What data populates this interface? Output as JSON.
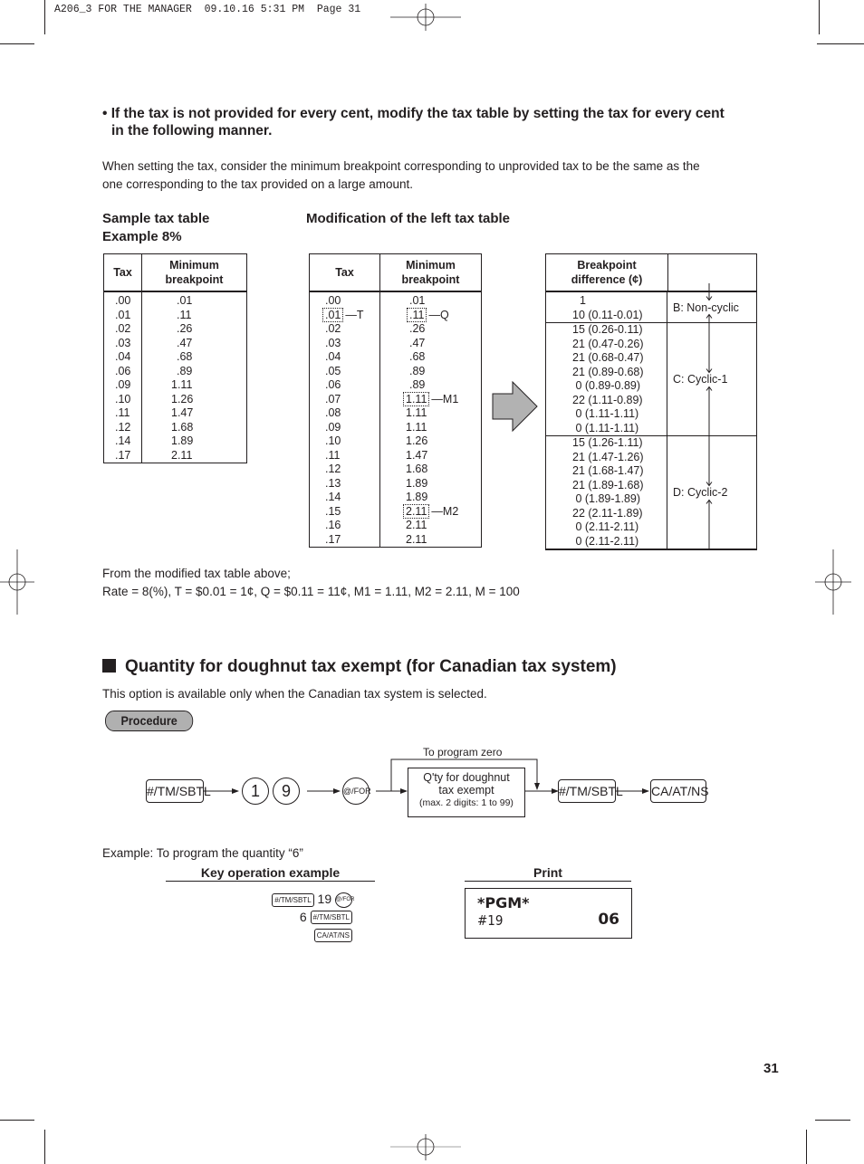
{
  "slug": "A206_3 FOR THE MANAGER  09.10.16 5:31 PM  Page 31",
  "bullet_heading": {
    "bullet": "•",
    "line1": "If the tax is not provided for every cent, modify the tax table by setting the tax for every cent",
    "line2": "in the following manner."
  },
  "intro_text": {
    "line1": "When setting the tax, consider the minimum breakpoint corresponding to unprovided tax to be the same as the",
    "line2": "one corresponding to the tax provided on a large amount."
  },
  "sample_table": {
    "title_line1": "Sample tax table",
    "title_line2": "Example 8%",
    "headers": [
      "Tax",
      "Minimum breakpoint"
    ],
    "rows": [
      [
        ".00",
        ".01"
      ],
      [
        ".01",
        ".11"
      ],
      [
        ".02",
        ".26"
      ],
      [
        ".03",
        ".47"
      ],
      [
        ".04",
        ".68"
      ],
      [
        ".06",
        ".89"
      ],
      [
        ".09",
        "1.11"
      ],
      [
        ".10",
        "1.26"
      ],
      [
        ".11",
        "1.47"
      ],
      [
        ".12",
        "1.68"
      ],
      [
        ".14",
        "1.89"
      ],
      [
        ".17",
        "2.11"
      ]
    ]
  },
  "modified_table": {
    "title": "Modification of the left tax table",
    "headers": [
      "Tax",
      "Minimum breakpoint"
    ],
    "rows": [
      {
        "tax": ".00",
        "bp": ".01",
        "tax_mark": "",
        "bp_mark": ""
      },
      {
        "tax": ".01",
        "bp": ".11",
        "tax_mark": "T",
        "bp_mark": "Q"
      },
      {
        "tax": ".02",
        "bp": ".26",
        "tax_mark": "",
        "bp_mark": ""
      },
      {
        "tax": ".03",
        "bp": ".47",
        "tax_mark": "",
        "bp_mark": ""
      },
      {
        "tax": ".04",
        "bp": ".68",
        "tax_mark": "",
        "bp_mark": ""
      },
      {
        "tax": ".05",
        "bp": ".89",
        "tax_mark": "",
        "bp_mark": ""
      },
      {
        "tax": ".06",
        "bp": ".89",
        "tax_mark": "",
        "bp_mark": ""
      },
      {
        "tax": ".07",
        "bp": "1.11",
        "tax_mark": "",
        "bp_mark": "M1"
      },
      {
        "tax": ".08",
        "bp": "1.11",
        "tax_mark": "",
        "bp_mark": ""
      },
      {
        "tax": ".09",
        "bp": "1.11",
        "tax_mark": "",
        "bp_mark": ""
      },
      {
        "tax": ".10",
        "bp": "1.26",
        "tax_mark": "",
        "bp_mark": ""
      },
      {
        "tax": ".11",
        "bp": "1.47",
        "tax_mark": "",
        "bp_mark": ""
      },
      {
        "tax": ".12",
        "bp": "1.68",
        "tax_mark": "",
        "bp_mark": ""
      },
      {
        "tax": ".13",
        "bp": "1.89",
        "tax_mark": "",
        "bp_mark": ""
      },
      {
        "tax": ".14",
        "bp": "1.89",
        "tax_mark": "",
        "bp_mark": ""
      },
      {
        "tax": ".15",
        "bp": "2.11",
        "tax_mark": "",
        "bp_mark": "M2"
      },
      {
        "tax": ".16",
        "bp": "2.11",
        "tax_mark": "",
        "bp_mark": ""
      },
      {
        "tax": ".17",
        "bp": "2.11",
        "tax_mark": "",
        "bp_mark": ""
      }
    ]
  },
  "diff_table": {
    "header": "Breakpoint difference (¢)",
    "groups": [
      {
        "label": "B: Non-cyclic",
        "rows": [
          "1",
          "10 (0.11-0.01)"
        ]
      },
      {
        "label": "C: Cyclic-1",
        "rows": [
          "15 (0.26-0.11)",
          "21 (0.47-0.26)",
          "21 (0.68-0.47)",
          "21 (0.89-0.68)",
          " 0 (0.89-0.89)",
          "22 (1.11-0.89)",
          " 0 (1.11-1.11)",
          " 0 (1.11-1.11)"
        ]
      },
      {
        "label": "D: Cyclic-2",
        "rows": [
          "15 (1.26-1.11)",
          "21 (1.47-1.26)",
          "21 (1.68-1.47)",
          "21 (1.89-1.68)",
          " 0 (1.89-1.89)",
          "22 (2.11-1.89)",
          " 0 (2.11-2.11)",
          " 0 (2.11-2.11)"
        ]
      }
    ]
  },
  "from_text": {
    "line1": "From the modified tax table above;",
    "line2": "Rate = 8(%), T = $0.01 = 1¢, Q = $0.11 = 11¢, M1 = 1.11, M2 = 2.11, M = 100"
  },
  "section": {
    "title": "Quantity for doughnut tax exempt (for Canadian tax system)",
    "description": "This option is available only when the Canadian tax system is selected.",
    "procedure_label": "Procedure"
  },
  "flow": {
    "key_sbtl": "#/TM/SBTL",
    "digit1": "1",
    "digit2": "9",
    "key_for": "@/FOR",
    "bypass_label": "To program zero",
    "qty_box_line1": "Q'ty for doughnut",
    "qty_box_line2": "tax exempt",
    "qty_box_line3": "(max. 2 digits: 1 to 99)",
    "key_sbtl2": "#/TM/SBTL",
    "key_ca": "CA/AT/NS"
  },
  "example": {
    "text": "Example:  To program the quantity “6”",
    "key_op_header": "Key operation example",
    "print_header": "Print",
    "line1_key": "#/TM/SBTL",
    "line1_num": "19",
    "line1_key2": "@/FOR",
    "line2_num": "6",
    "line2_key": "#/TM/SBTL",
    "line3_key": "CA/AT/NS",
    "print_line1": "*PGM*",
    "print_line2_left": "#19",
    "print_line2_right": "06"
  },
  "page_number": "31"
}
